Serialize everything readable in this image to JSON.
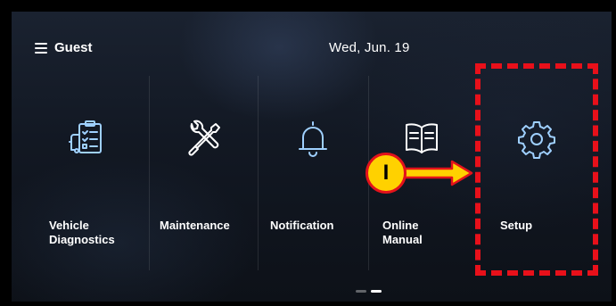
{
  "header": {
    "menu_label": "Guest",
    "date": "Wed, Jun. 19"
  },
  "tiles": [
    {
      "label": "Vehicle\nDiagnostics",
      "icon": "vehicle-diagnostics-icon"
    },
    {
      "label": "Maintenance",
      "icon": "wrench-screwdriver-icon"
    },
    {
      "label": "Notification",
      "icon": "bell-icon"
    },
    {
      "label": "Online\nManual",
      "icon": "book-icon"
    },
    {
      "label": "Setup",
      "icon": "gear-icon"
    }
  ],
  "callout": {
    "label": "I"
  },
  "pager": {
    "pages": 2,
    "current": 2
  },
  "colors": {
    "icon_blue": "#9fd0ff",
    "highlight_red": "#e8101a",
    "callout_yellow": "#ffd100"
  }
}
